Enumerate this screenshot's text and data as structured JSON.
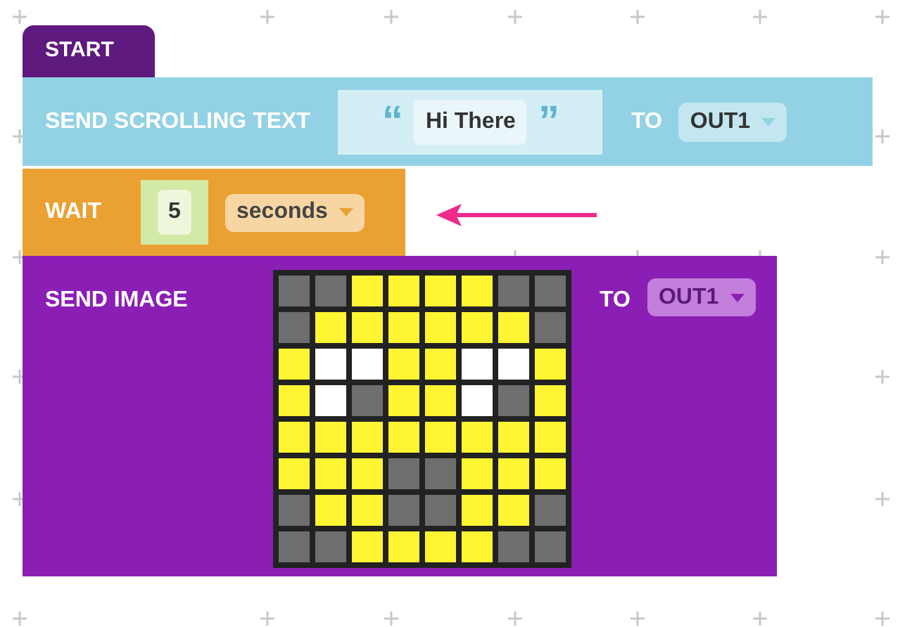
{
  "blocks": [
    {
      "kind": "start",
      "label": "START"
    },
    {
      "kind": "send_text",
      "label": "SEND SCROLLING TEXT",
      "open_quote": "“",
      "text": "Hi There",
      "close_quote": "”",
      "to": "TO",
      "port": "OUT1"
    },
    {
      "kind": "wait",
      "label": "WAIT",
      "value": "5",
      "unit": "seconds"
    },
    {
      "kind": "send_image",
      "label": "SEND IMAGE",
      "to": "TO",
      "port": "OUT1",
      "pixels": [
        [
          {
            "color": "#6e6e6e"
          },
          {
            "color": "#6e6e6e"
          },
          {
            "color": "#fff533"
          },
          {
            "color": "#fff533"
          },
          {
            "color": "#fff533"
          },
          {
            "color": "#fff533"
          },
          {
            "color": "#6e6e6e"
          },
          {
            "color": "#6e6e6e"
          }
        ],
        [
          {
            "color": "#6e6e6e"
          },
          {
            "color": "#fff533"
          },
          {
            "color": "#fff533"
          },
          {
            "color": "#fff533"
          },
          {
            "color": "#fff533"
          },
          {
            "color": "#fff533"
          },
          {
            "color": "#fff533"
          },
          {
            "color": "#6e6e6e"
          }
        ],
        [
          {
            "color": "#fff533"
          },
          {
            "color": "#ffffff"
          },
          {
            "color": "#ffffff"
          },
          {
            "color": "#fff533"
          },
          {
            "color": "#fff533"
          },
          {
            "color": "#ffffff"
          },
          {
            "color": "#ffffff"
          },
          {
            "color": "#fff533"
          }
        ],
        [
          {
            "color": "#fff533"
          },
          {
            "color": "#ffffff"
          },
          {
            "color": "#6e6e6e"
          },
          {
            "color": "#fff533"
          },
          {
            "color": "#fff533"
          },
          {
            "color": "#ffffff"
          },
          {
            "color": "#6e6e6e"
          },
          {
            "color": "#fff533"
          }
        ],
        [
          {
            "color": "#fff533"
          },
          {
            "color": "#fff533"
          },
          {
            "color": "#fff533"
          },
          {
            "color": "#fff533"
          },
          {
            "color": "#fff533"
          },
          {
            "color": "#fff533"
          },
          {
            "color": "#fff533"
          },
          {
            "color": "#fff533"
          }
        ],
        [
          {
            "color": "#fff533"
          },
          {
            "color": "#fff533"
          },
          {
            "color": "#fff533"
          },
          {
            "color": "#6e6e6e"
          },
          {
            "color": "#6e6e6e"
          },
          {
            "color": "#fff533"
          },
          {
            "color": "#fff533"
          },
          {
            "color": "#fff533"
          }
        ],
        [
          {
            "color": "#6e6e6e"
          },
          {
            "color": "#fff533"
          },
          {
            "color": "#fff533"
          },
          {
            "color": "#6e6e6e"
          },
          {
            "color": "#6e6e6e"
          },
          {
            "color": "#fff533"
          },
          {
            "color": "#fff533"
          },
          {
            "color": "#6e6e6e"
          }
        ],
        [
          {
            "color": "#6e6e6e"
          },
          {
            "color": "#6e6e6e"
          },
          {
            "color": "#fff533"
          },
          {
            "color": "#fff533"
          },
          {
            "color": "#fff533"
          },
          {
            "color": "#fff533"
          },
          {
            "color": "#6e6e6e"
          },
          {
            "color": "#6e6e6e"
          }
        ]
      ]
    }
  ]
}
